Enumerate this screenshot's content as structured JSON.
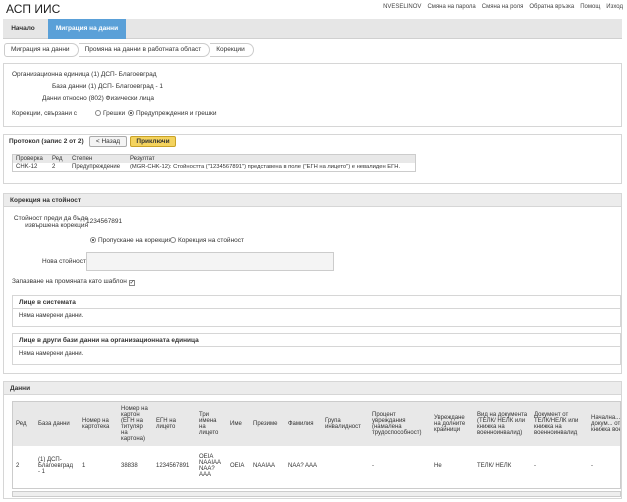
{
  "app": {
    "title": "АСП ИИС"
  },
  "top_links": [
    "NVESELINOV",
    "Смяна на парола",
    "Смяна на роля",
    "Обратна връзка",
    "Помощ",
    "Изход"
  ],
  "nav": {
    "home": "Начало",
    "active": "Миграция на данни"
  },
  "breadcrumb": [
    "Миграция на данни",
    "Промяна на данни в работната област",
    "Корекции"
  ],
  "info": {
    "org_label": "Организационна единица",
    "org_value": "(1) ДСП- Благоевград",
    "db_label": "База данни",
    "db_value": "(1) ДСП- Благоевград - 1",
    "data_label": "Данни относно",
    "data_value": "(802) Физически лица",
    "corr_label": "Корекции, свързани с",
    "opt_errors": "Грешки",
    "opt_warnings": "Предупреждения и грешки"
  },
  "protocol": {
    "title": "Протокол (запис 2 от 2)",
    "back": "< Назад",
    "finish": "Приключи",
    "headers": [
      "Проверка",
      "Ред",
      "Степен",
      "Резултат"
    ],
    "rows": [
      [
        "CHK-12",
        "2",
        "Предупреждение",
        "(MGR-CHK-12): Стойността (\"1234567891\") представена в поле (\"ЕГН на лицето\") е невалиден ЕГН."
      ]
    ]
  },
  "correction": {
    "title": "Корекция на стойност",
    "before_label": "Стойност преди да бъде извършена корекция",
    "before_value": "1234567891",
    "opt_skip": "Пропускане на корекция",
    "opt_fix": "Корекция на стойност",
    "new_value_label": "Нова стойност",
    "template_label": "Запазване на промяната като шаблон",
    "template_check": "✓",
    "persons_title": "Лице в системата",
    "persons_empty": "Няма намерени данни.",
    "other_title": "Лице в други бази данни на организационната единица",
    "other_empty": "Няма намерени данни."
  },
  "data_panel": {
    "title": "Данни",
    "headers": [
      "Ред",
      "База данни",
      "Номер на картотека",
      "Номер на картон (ЕГН на титуляр на картона)",
      "ЕГН на лицето",
      "Три имена на лицето",
      "Име",
      "Презиме",
      "Фамилия",
      "Група инвалидност",
      "Процент увреждания (намалена трудоспособност)",
      "Увреждане на долните крайници",
      "Вид на документа (ТЕЛК/ НЕЛК или книжка на военноинвалид)",
      "Документ от ТЕЛК/НЕЛК или книжка на военноинвалид",
      "Начална... на докум... от ТЕЛК или книжка военно..."
    ],
    "rows": [
      [
        "2",
        "(1) ДСП-Благоевград - 1",
        "1",
        "38838",
        "1234567891",
        "ОЕІА NAAIAA NAA? AAA",
        "ОЕІА",
        "NAAIAA",
        "NAA? AAA",
        "",
        "-",
        "Не",
        "ТЕЛК/ НЕЛК",
        "-",
        "-"
      ]
    ]
  }
}
